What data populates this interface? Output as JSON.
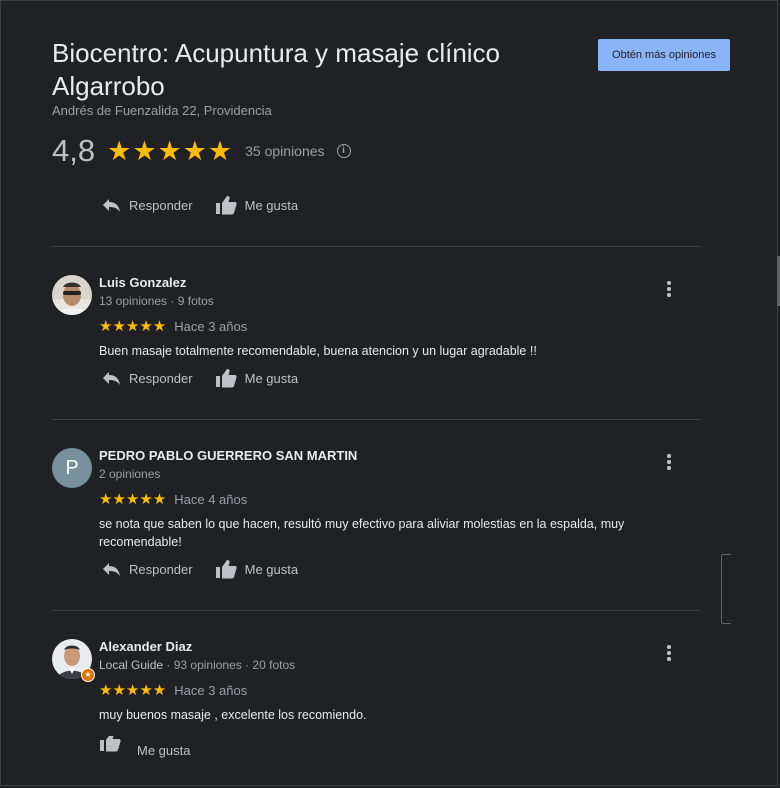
{
  "place": {
    "name": "Biocentro: Acupuntura y masaje clínico Algarrobo",
    "address": "Andrés de Fuenzalida 22, Providencia",
    "rating": "4,8",
    "stars": "★★★★★",
    "review_count": "35 opiniones",
    "info_icon": "i"
  },
  "header_button": {
    "label": "Obtén más opiniones"
  },
  "actions": {
    "reply": "Responder",
    "like": "Me gusta"
  },
  "reviews": [
    {
      "name": "Luis Gonzalez",
      "meta": "13 opiniones · 9 fotos",
      "stars": "★★★★★",
      "ago": "Hace 3 años",
      "text": "Buen masaje totalmente recomendable, buena atencion y un lugar agradable !!"
    },
    {
      "name": "PEDRO PABLO GUERRERO SAN MARTIN",
      "avatar_letter": "P",
      "meta": "2 opiniones",
      "stars": "★★★★★",
      "ago": "Hace 4 años",
      "text": "se nota que saben lo que hacen, resultó muy efectivo para aliviar molestias en la espalda, muy recomendable!"
    },
    {
      "name": "Alexander Diaz",
      "local_guide": "Local Guide",
      "meta": " · 93 opiniones · 20 fotos",
      "stars": "★★★★★",
      "ago": "Hace 3 años",
      "text": "muy buenos masaje , excelente los recomiendo."
    }
  ],
  "colors": {
    "background": "#202124",
    "star": "#fbbc04",
    "button": "#8ab4f8",
    "local_guide_badge": "#e37400"
  }
}
